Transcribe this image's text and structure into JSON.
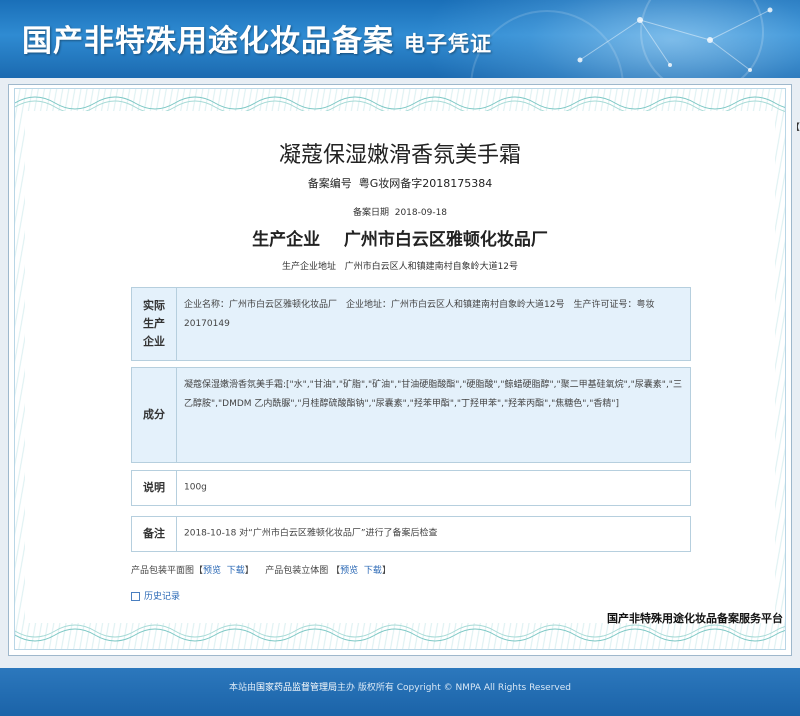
{
  "header": {
    "title": "国产非特殊用途化妆品备案",
    "subtitle": "电子凭证"
  },
  "certificate": {
    "product_name": "凝蔻保湿嫩滑香氛美手霜",
    "registration_no_label": "备案编号",
    "registration_no": "粤G妆网备字2018175384",
    "registration_date_label": "备案日期",
    "registration_date": "2018-09-18",
    "producer_label": "生产企业",
    "producer": "广州市白云区雅顿化妆品厂",
    "address_label": "生产企业地址",
    "address": "广州市白云区人和镇建南村自象岭大道12号"
  },
  "sections": {
    "actual": {
      "label": "实际生产企业",
      "text": "企业名称：广州市白云区雅顿化妆品厂　企业地址：广州市白云区人和镇建南村自象岭大道12号　生产许可证号：粤妆20170149"
    },
    "ingredients": {
      "label": "成分",
      "text": "凝蔻保湿嫩滑香氛美手霜:[\"水\",\"甘油\",\"矿脂\",\"矿油\",\"甘油硬脂酸酯\",\"硬脂酸\",\"鲸蜡硬脂醇\",\"聚二甲基硅氧烷\",\"尿囊素\",\"三乙醇胺\",\"DMDM 乙内酰脲\",\"月桂醇硫酸酯钠\",\"尿囊素\",\"羟苯甲酯\",\"丁羟甲苯\",\"羟苯丙酯\",\"焦糖色\",\"香精\"]"
    },
    "note": {
      "label": "说明",
      "text": "100g"
    },
    "remark": {
      "label": "备注",
      "text": "2018-10-18 对“广州市白云区雅顿化妆品厂”进行了备案后检查"
    }
  },
  "package": {
    "flat_label": "产品包装平面图",
    "preview": "预览",
    "download": "下载",
    "solid_label": "产品包装立体图",
    "bracket_open": "【",
    "bracket_close": "】"
  },
  "history_link": "历史记录",
  "platform_name": "国产非特殊用途化妆品备案服务平台",
  "right_mark": "【",
  "footer": {
    "prefix": "本站由",
    "org": "国家药品监督管理局",
    "suffix": "主办 版权所有 Copyright © NMPA All Rights Reserved"
  },
  "colors": {
    "header_blue": "#1a6fb8",
    "panel_blue": "#e4f1fb",
    "link_blue": "#2a68b5"
  }
}
